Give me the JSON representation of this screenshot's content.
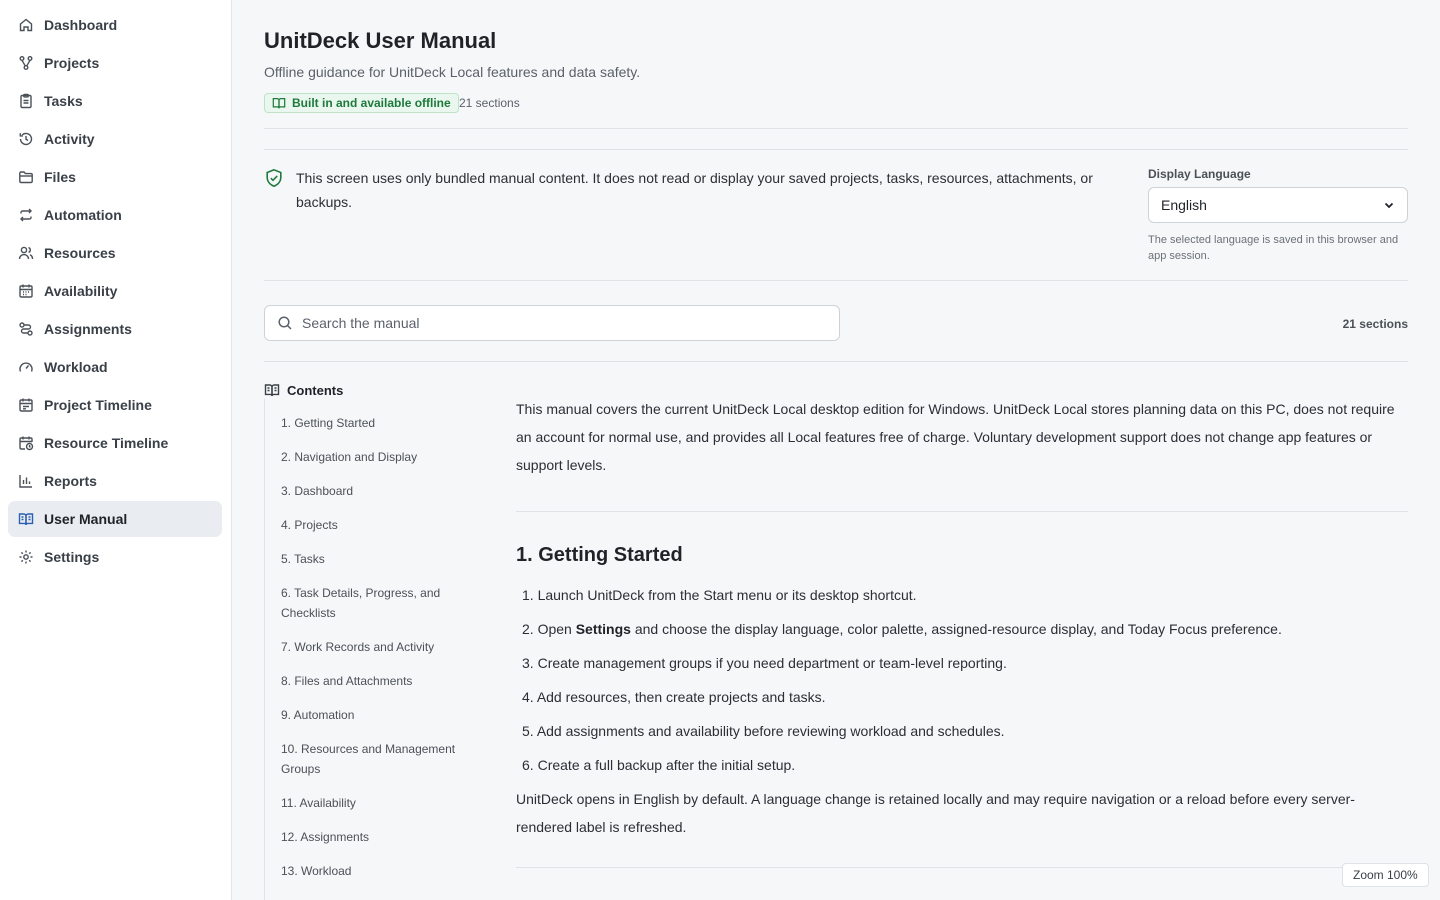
{
  "sidebar": {
    "items": [
      {
        "label": "Dashboard",
        "icon": "home-icon"
      },
      {
        "label": "Projects",
        "icon": "projects-icon"
      },
      {
        "label": "Tasks",
        "icon": "clipboard-icon"
      },
      {
        "label": "Activity",
        "icon": "history-icon"
      },
      {
        "label": "Files",
        "icon": "folder-icon"
      },
      {
        "label": "Automation",
        "icon": "repeat-icon"
      },
      {
        "label": "Resources",
        "icon": "users-icon"
      },
      {
        "label": "Availability",
        "icon": "calendar-icon"
      },
      {
        "label": "Assignments",
        "icon": "route-icon"
      },
      {
        "label": "Workload",
        "icon": "gauge-icon"
      },
      {
        "label": "Project Timeline",
        "icon": "calendar-range-icon"
      },
      {
        "label": "Resource Timeline",
        "icon": "calendar-clock-icon"
      },
      {
        "label": "Reports",
        "icon": "bar-chart-icon"
      },
      {
        "label": "User Manual",
        "icon": "book-open-icon",
        "active": true
      },
      {
        "label": "Settings",
        "icon": "gear-icon"
      }
    ]
  },
  "header": {
    "title": "UnitDeck User Manual",
    "subtitle": "Offline guidance for UnitDeck Local features and data safety.",
    "badge": "Built in and available offline",
    "section_count": "21 sections"
  },
  "notice": {
    "text": "This screen uses only bundled manual content. It does not read or display your saved projects, tasks, resources, attachments, or backups."
  },
  "language": {
    "label": "Display Language",
    "selected": "English",
    "hint": "The selected language is saved in this browser and app session."
  },
  "search": {
    "placeholder": "Search the manual",
    "value": "",
    "count": "21 sections"
  },
  "toc": {
    "heading": "Contents",
    "items": [
      "1. Getting Started",
      "2. Navigation and Display",
      "3. Dashboard",
      "4. Projects",
      "5. Tasks",
      "6. Task Details, Progress, and Checklists",
      "7. Work Records and Activity",
      "8. Files and Attachments",
      "9. Automation",
      "10. Resources and Management Groups",
      "11. Availability",
      "12. Assignments",
      "13. Workload"
    ]
  },
  "content": {
    "intro": "This manual covers the current UnitDeck Local desktop edition for Windows. UnitDeck Local stores planning data on this PC, does not require an account for normal use, and provides all Local features free of charge. Voluntary development support does not change app features or support levels.",
    "section1_title": "1. Getting Started",
    "steps": [
      {
        "num": "1.",
        "pre": "Launch UnitDeck from the Start menu or its desktop shortcut.",
        "bold": "",
        "post": ""
      },
      {
        "num": "2.",
        "pre": "Open ",
        "bold": "Settings",
        "post": " and choose the display language, color palette, assigned-resource display, and Today Focus preference."
      },
      {
        "num": "3.",
        "pre": "Create management groups if you need department or team-level reporting.",
        "bold": "",
        "post": ""
      },
      {
        "num": "4.",
        "pre": "Add resources, then create projects and tasks.",
        "bold": "",
        "post": ""
      },
      {
        "num": "5.",
        "pre": "Add assignments and availability before reviewing workload and schedules.",
        "bold": "",
        "post": ""
      },
      {
        "num": "6.",
        "pre": "Create a full backup after the initial setup.",
        "bold": "",
        "post": ""
      }
    ],
    "outro": "UnitDeck opens in English by default. A language change is retained locally and may require navigation or a reload before every server-rendered label is refreshed."
  },
  "zoom": "Zoom 100%",
  "colors": {
    "accent": "#2b5fb4",
    "success": "#1e7a3c",
    "success_bg": "#eaf7ee"
  }
}
